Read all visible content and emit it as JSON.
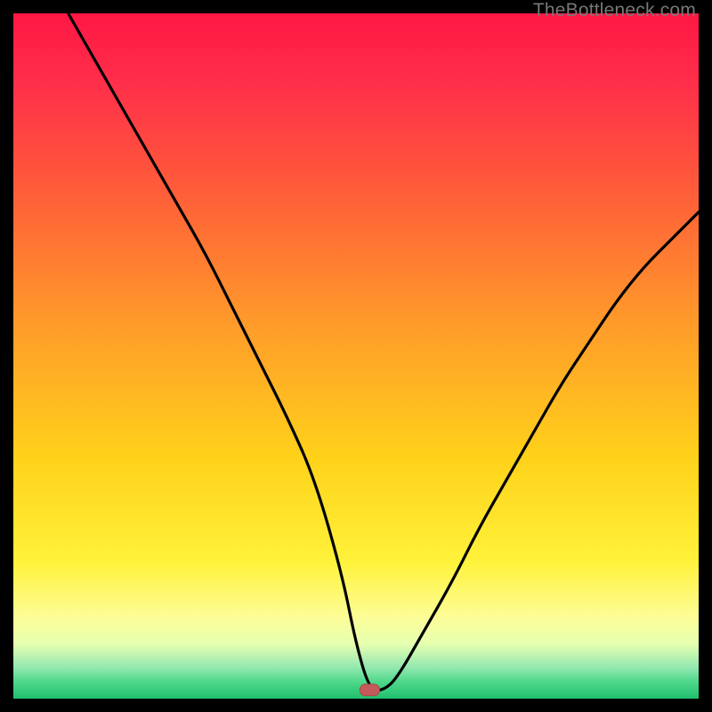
{
  "watermark": "TheBottleneck.com",
  "colors": {
    "black": "#000000",
    "curve": "#000000",
    "marker_fill": "#c45a5a",
    "marker_stroke": "#a94848",
    "gradient_stops": [
      {
        "offset": 0.0,
        "color": "#ff1744"
      },
      {
        "offset": 0.1,
        "color": "#ff2e4a"
      },
      {
        "offset": 0.25,
        "color": "#ff5a3a"
      },
      {
        "offset": 0.45,
        "color": "#ff9a2a"
      },
      {
        "offset": 0.65,
        "color": "#ffd21a"
      },
      {
        "offset": 0.8,
        "color": "#fff23a"
      },
      {
        "offset": 0.88,
        "color": "#fdfd96"
      },
      {
        "offset": 0.92,
        "color": "#e6ffb0"
      },
      {
        "offset": 0.955,
        "color": "#92e8b0"
      },
      {
        "offset": 0.975,
        "color": "#4fd88a"
      },
      {
        "offset": 1.0,
        "color": "#1fbf6f"
      }
    ]
  },
  "chart_data": {
    "type": "line",
    "title": "",
    "xlabel": "",
    "ylabel": "",
    "xlim": [
      0,
      100
    ],
    "ylim": [
      0,
      100
    ],
    "grid": false,
    "legend": false,
    "marker": {
      "x": 52,
      "y": 1.2
    },
    "series": [
      {
        "name": "bottleneck-curve",
        "x": [
          8,
          12,
          16,
          20,
          24,
          28,
          32,
          36,
          40,
          44,
          48,
          50,
          52,
          54,
          56,
          60,
          64,
          68,
          72,
          76,
          80,
          84,
          88,
          92,
          96,
          100
        ],
        "y": [
          100,
          93,
          86,
          79,
          72,
          65,
          57,
          49,
          41,
          32,
          18,
          8,
          1.2,
          1.2,
          3,
          10,
          17,
          25,
          32,
          39,
          46,
          52,
          58,
          63,
          67,
          71
        ]
      }
    ]
  }
}
